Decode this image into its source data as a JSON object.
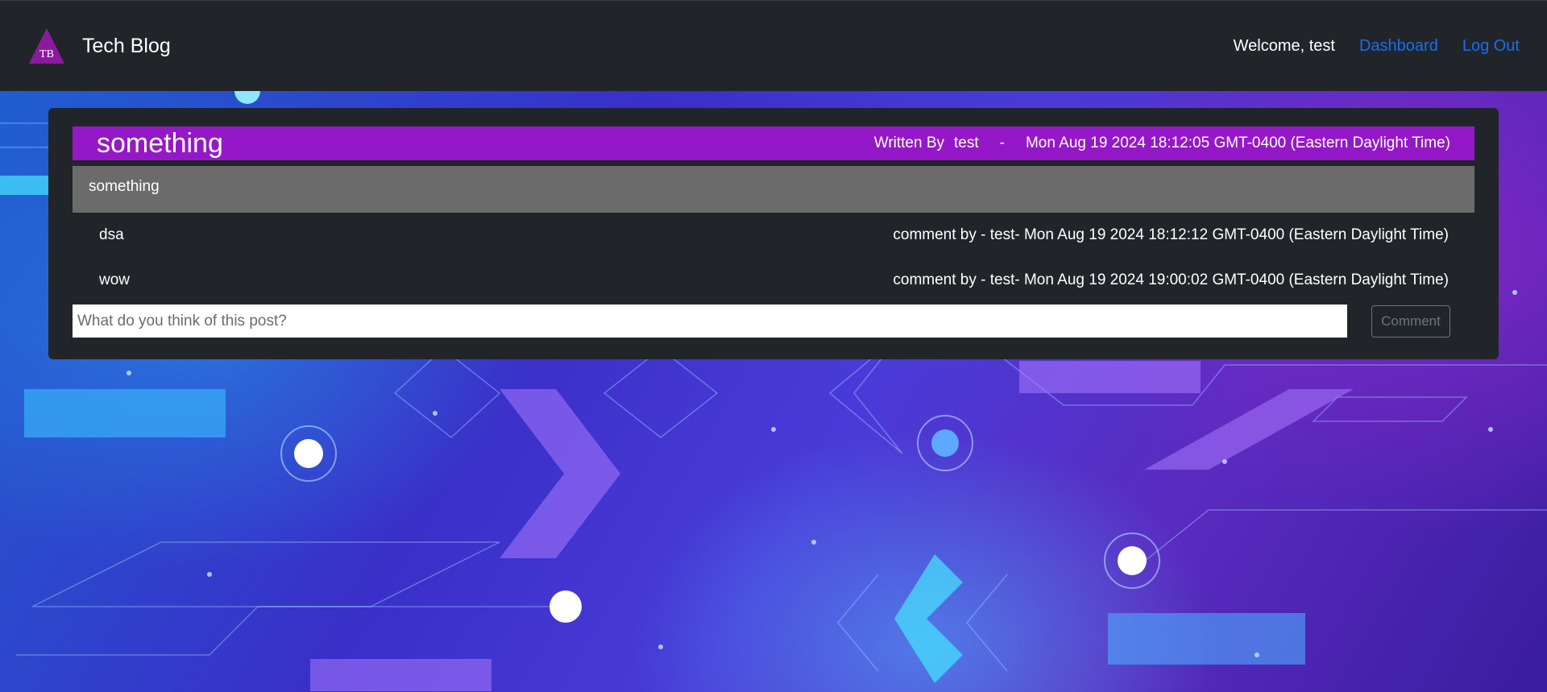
{
  "nav": {
    "logo_text": "TB",
    "brand": "Tech Blog",
    "welcome": "Welcome, test",
    "links": [
      "Dashboard",
      "Log Out"
    ]
  },
  "post": {
    "title": "something",
    "written_by_label": "Written By",
    "author": "test",
    "separator": "-",
    "date": "Mon Aug 19 2024 18:12:05 GMT-0400 (Eastern Daylight Time)",
    "body": "something"
  },
  "comments": [
    {
      "text": "dsa",
      "meta": "comment by - test- Mon Aug 19 2024 18:12:12 GMT-0400 (Eastern Daylight Time)"
    },
    {
      "text": "wow",
      "meta": "comment by - test- Mon Aug 19 2024 19:00:02 GMT-0400 (Eastern Daylight Time)"
    }
  ],
  "comment_form": {
    "placeholder": "What do you think of this post?",
    "button": "Comment"
  },
  "colors": {
    "navbar": "#212529",
    "link": "#1a6cf0",
    "post_header": "#9518c8",
    "post_body": "#6b6b6b"
  }
}
